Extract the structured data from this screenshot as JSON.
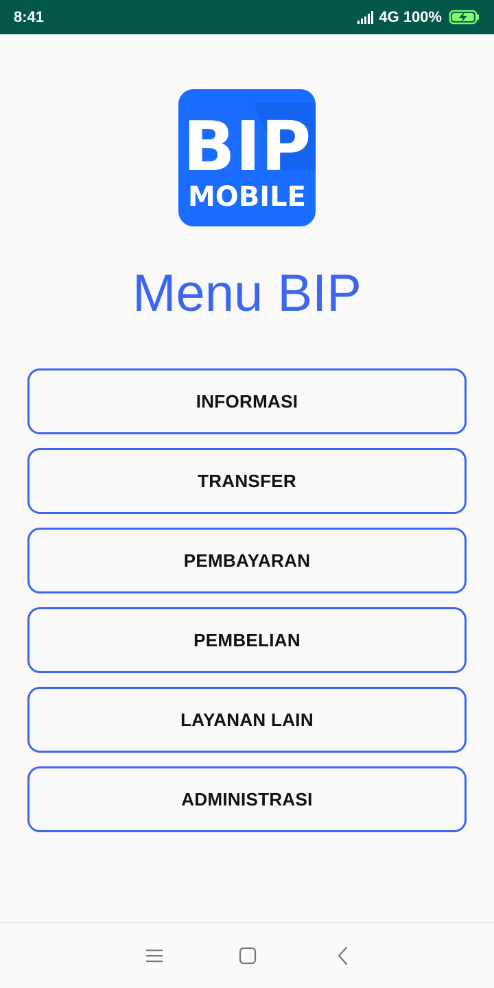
{
  "status_bar": {
    "time": "8:41",
    "network": "4G",
    "battery": "100%",
    "signal_icon": "signal-bars-icon",
    "battery_icon": "battery-charging-icon"
  },
  "logo": {
    "line1": "BIP",
    "line2": "MOBILE",
    "color": "#1a6cff"
  },
  "page": {
    "title": "Menu BIP",
    "accent_color": "#3d66f0"
  },
  "menu": {
    "items": [
      {
        "label": "INFORMASI"
      },
      {
        "label": "TRANSFER"
      },
      {
        "label": "PEMBAYARAN"
      },
      {
        "label": "PEMBELIAN"
      },
      {
        "label": "LAYANAN LAIN"
      },
      {
        "label": "ADMINISTRASI"
      }
    ]
  },
  "nav_bar": {
    "menu_icon": "hamburger-icon",
    "home_icon": "square-home-icon",
    "back_icon": "chevron-back-icon"
  }
}
